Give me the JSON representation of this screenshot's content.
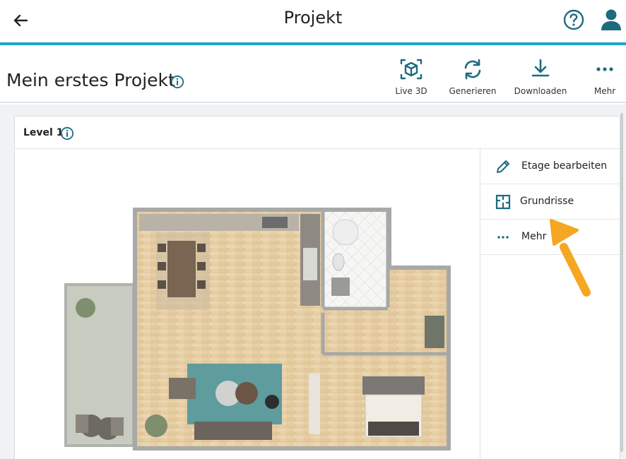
{
  "appbar": {
    "title": "Projekt",
    "accent": "#1ba7c9"
  },
  "project": {
    "title": "Mein erstes Projekt"
  },
  "toolbar": {
    "live3d_label": "Live 3D",
    "generate_label": "Generieren",
    "download_label": "Downloaden",
    "more_label": "Mehr"
  },
  "level": {
    "label": "Level 1"
  },
  "side_menu": {
    "edit_floor": "Etage bearbeiten",
    "floorplans": "Grundrisse",
    "more": "Mehr"
  },
  "icons": {
    "back": "arrow-left-icon",
    "help": "question-circle-icon",
    "user": "user-icon",
    "info": "info-circle-icon",
    "live3d": "cube-icon",
    "generate": "refresh-icon",
    "download": "download-icon",
    "more": "dots-horizontal-icon",
    "edit": "pencil-icon",
    "floorplan": "floorplan-icon"
  },
  "colors": {
    "icon_teal": "#1e6b80",
    "highlight_arrow": "#f5a623"
  }
}
